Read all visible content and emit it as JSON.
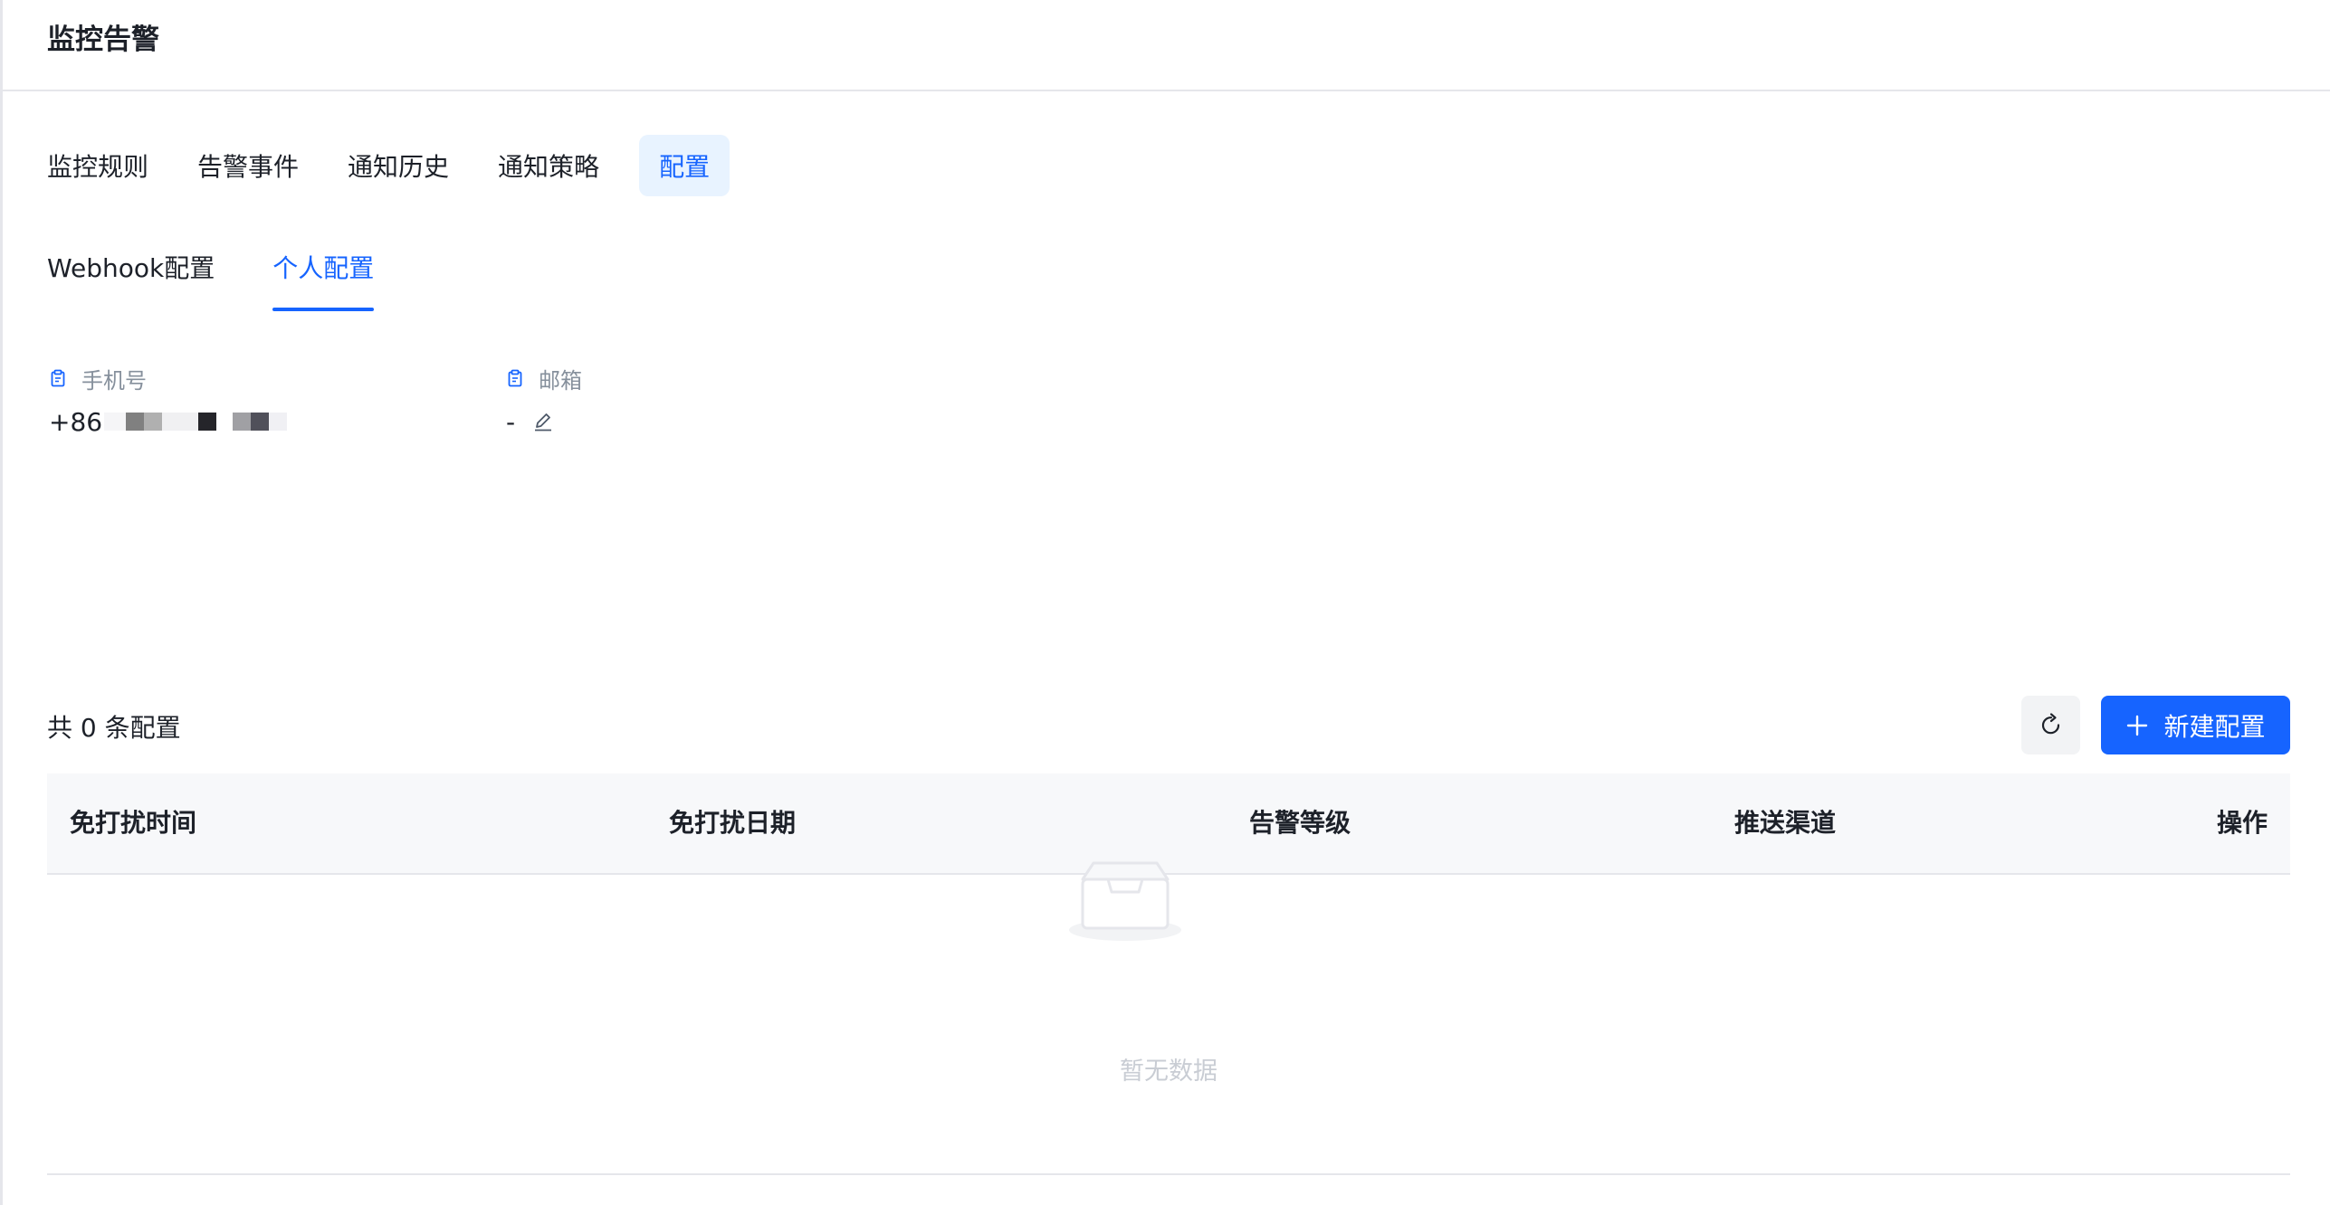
{
  "header": {
    "title": "监控告警"
  },
  "tabs": [
    {
      "label": "监控规则"
    },
    {
      "label": "告警事件"
    },
    {
      "label": "通知历史"
    },
    {
      "label": "通知策略"
    },
    {
      "label": "配置",
      "active": true
    }
  ],
  "subtabs": [
    {
      "label": "Webhook配置"
    },
    {
      "label": "个人配置",
      "active": true
    }
  ],
  "profile": {
    "phone": {
      "label": "手机号",
      "value_prefix": "+86",
      "icon": "clipboard-icon"
    },
    "email": {
      "label": "邮箱",
      "value": "-",
      "icon": "clipboard-icon",
      "edit_icon": "pencil-icon"
    }
  },
  "toolbar": {
    "count_text": "共 0 条配置",
    "refresh_icon": "refresh-icon",
    "new_button_label": "新建配置",
    "new_button_icon": "plus-icon"
  },
  "table": {
    "columns": [
      "免打扰时间",
      "免打扰日期",
      "告警等级",
      "推送渠道",
      "操作"
    ],
    "rows": [],
    "empty_text": "暂无数据",
    "empty_icon": "empty-inbox-icon"
  },
  "colors": {
    "primary": "#1664ff",
    "active_tab_bg": "#e8f3ff",
    "text_primary": "#1d2129",
    "text_secondary": "#86909c",
    "border": "#e5e6eb",
    "table_header_bg": "#f7f8fa"
  }
}
